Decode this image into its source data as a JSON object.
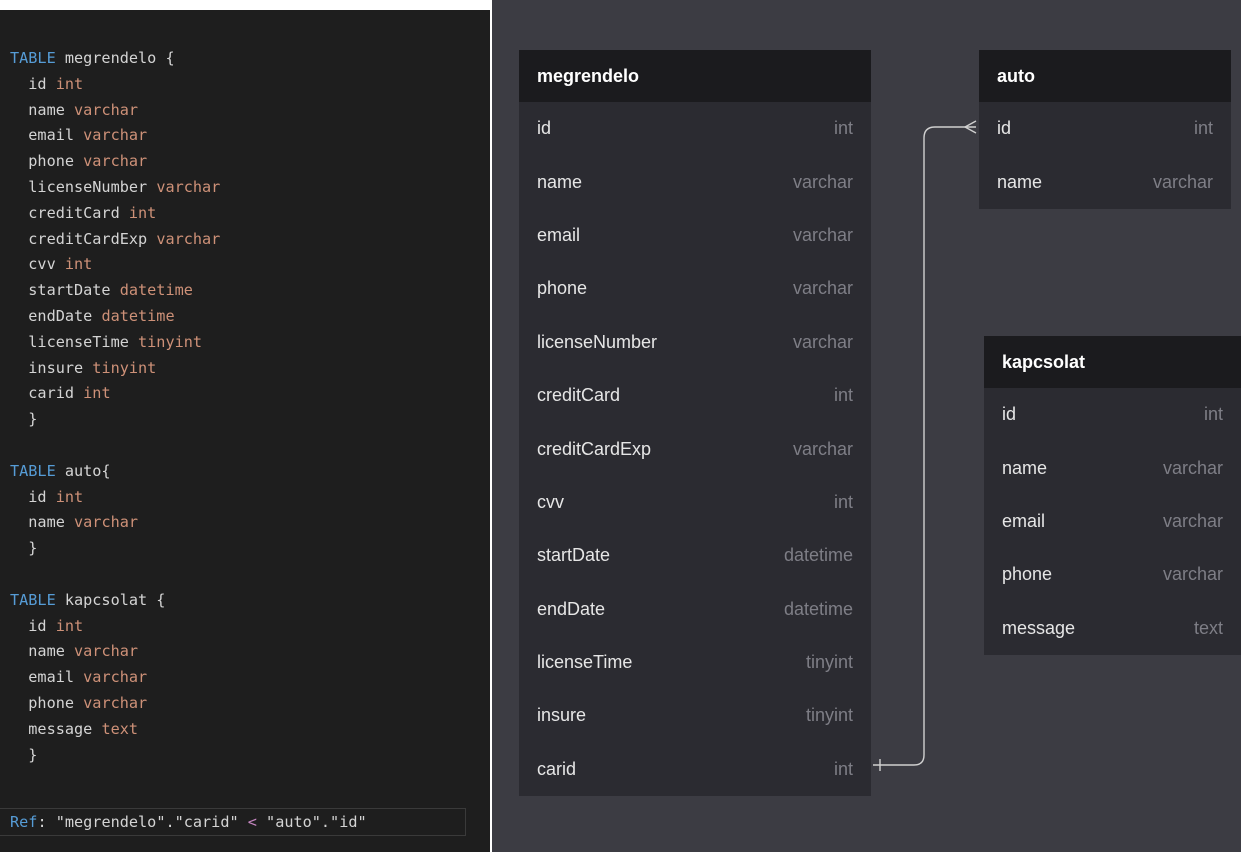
{
  "code": {
    "lines": [
      {
        "kw": "TABLE",
        "name": " megrendelo {",
        "type": ""
      },
      {
        "kw": "",
        "name": "  id ",
        "type": "int"
      },
      {
        "kw": "",
        "name": "  name ",
        "type": "varchar"
      },
      {
        "kw": "",
        "name": "  email ",
        "type": "varchar"
      },
      {
        "kw": "",
        "name": "  phone ",
        "type": "varchar"
      },
      {
        "kw": "",
        "name": "  licenseNumber ",
        "type": "varchar"
      },
      {
        "kw": "",
        "name": "  creditCard ",
        "type": "int"
      },
      {
        "kw": "",
        "name": "  creditCardExp ",
        "type": "varchar"
      },
      {
        "kw": "",
        "name": "  cvv ",
        "type": "int"
      },
      {
        "kw": "",
        "name": "  startDate ",
        "type": "datetime"
      },
      {
        "kw": "",
        "name": "  endDate ",
        "type": "datetime"
      },
      {
        "kw": "",
        "name": "  licenseTime ",
        "type": "tinyint"
      },
      {
        "kw": "",
        "name": "  insure ",
        "type": "tinyint"
      },
      {
        "kw": "",
        "name": "  carid ",
        "type": "int"
      },
      {
        "kw": "",
        "name": "  }",
        "type": ""
      },
      {
        "kw": "",
        "name": "",
        "type": ""
      },
      {
        "kw": "TABLE",
        "name": " auto{",
        "type": ""
      },
      {
        "kw": "",
        "name": "  id ",
        "type": "int"
      },
      {
        "kw": "",
        "name": "  name ",
        "type": "varchar"
      },
      {
        "kw": "",
        "name": "  }",
        "type": ""
      },
      {
        "kw": "",
        "name": "",
        "type": ""
      },
      {
        "kw": "TABLE",
        "name": " kapcsolat {",
        "type": ""
      },
      {
        "kw": "",
        "name": "  id ",
        "type": "int"
      },
      {
        "kw": "",
        "name": "  name ",
        "type": "varchar"
      },
      {
        "kw": "",
        "name": "  email ",
        "type": "varchar"
      },
      {
        "kw": "",
        "name": "  phone ",
        "type": "varchar"
      },
      {
        "kw": "",
        "name": "  message ",
        "type": "text"
      },
      {
        "kw": "",
        "name": "  }",
        "type": ""
      }
    ],
    "ref": {
      "keyword": "Ref",
      "sep": ": ",
      "left": "\"megrendelo\".\"carid\"",
      "op": " < ",
      "right": "\"auto\".\"id\""
    }
  },
  "diagram": {
    "tables": [
      {
        "name": "megrendelo",
        "columns": [
          {
            "name": "id",
            "type": "int"
          },
          {
            "name": "name",
            "type": "varchar"
          },
          {
            "name": "email",
            "type": "varchar"
          },
          {
            "name": "phone",
            "type": "varchar"
          },
          {
            "name": "licenseNumber",
            "type": "varchar"
          },
          {
            "name": "creditCard",
            "type": "int"
          },
          {
            "name": "creditCardExp",
            "type": "varchar"
          },
          {
            "name": "cvv",
            "type": "int"
          },
          {
            "name": "startDate",
            "type": "datetime"
          },
          {
            "name": "endDate",
            "type": "datetime"
          },
          {
            "name": "licenseTime",
            "type": "tinyint"
          },
          {
            "name": "insure",
            "type": "tinyint"
          },
          {
            "name": "carid",
            "type": "int"
          }
        ]
      },
      {
        "name": "auto",
        "columns": [
          {
            "name": "id",
            "type": "int"
          },
          {
            "name": "name",
            "type": "varchar"
          }
        ]
      },
      {
        "name": "kapcsolat",
        "columns": [
          {
            "name": "id",
            "type": "int"
          },
          {
            "name": "name",
            "type": "varchar"
          },
          {
            "name": "email",
            "type": "varchar"
          },
          {
            "name": "phone",
            "type": "varchar"
          },
          {
            "name": "message",
            "type": "text"
          }
        ]
      }
    ]
  },
  "colors": {
    "editor_bg": "#1e1e1e",
    "keyword": "#569cd6",
    "type": "#ce9178",
    "canvas_bg": "#3c3c43",
    "table_header": "#1b1b1e",
    "table_body": "#2b2b31",
    "relation_line": "#d0d0d0"
  }
}
